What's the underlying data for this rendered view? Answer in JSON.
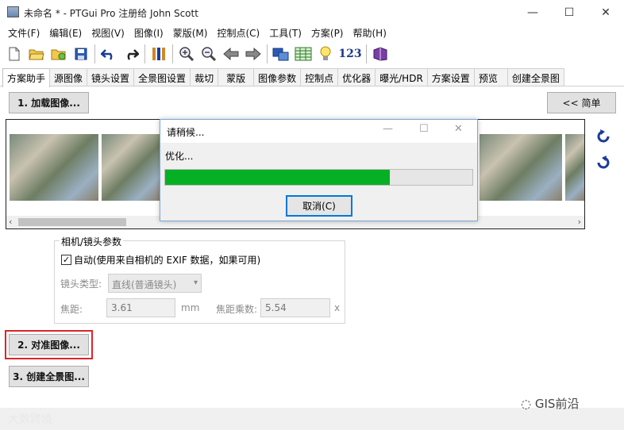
{
  "window": {
    "title": "未命名 * - PTGui Pro 注册给 John Scott",
    "minimize": "—",
    "maximize": "☐",
    "close": "✕"
  },
  "menu": [
    "文件(F)",
    "编辑(E)",
    "视图(V)",
    "图像(I)",
    "蒙版(M)",
    "控制点(C)",
    "工具(T)",
    "方案(P)",
    "帮助(H)"
  ],
  "toolbar": {
    "number_label": "123"
  },
  "tabs": [
    "方案助手",
    "源图像",
    "镜头设置",
    "全景图设置",
    "裁切",
    "蒙版",
    "图像参数",
    "控制点",
    "优化器",
    "曝光/HDR",
    "方案设置",
    "预览",
    "创建全景图"
  ],
  "active_tab": "方案助手",
  "buttons": {
    "load_images": "1. 加载图像...",
    "simple": "<< 简单",
    "align_images": "2. 对准图像...",
    "create_panorama": "3. 创建全景图..."
  },
  "dialog": {
    "title": "请稍候...",
    "message": "优化...",
    "progress": 0.73,
    "cancel": "取消(C)"
  },
  "camera": {
    "legend": "相机/镜头参数",
    "auto_checked": true,
    "auto_label": "自动(使用来自相机的 EXIF 数据，如果可用)",
    "lens_type_label": "镜头类型:",
    "lens_type_value": "直线(普通镜头)",
    "focal_label": "焦距:",
    "focal_value": "3.61",
    "focal_unit": "mm",
    "multiplier_label": "焦距乘数:",
    "multiplier_value": "5.54",
    "multiplier_unit": "x"
  },
  "watermark": {
    "left": "大数跨境",
    "right": "GIS前沿"
  }
}
